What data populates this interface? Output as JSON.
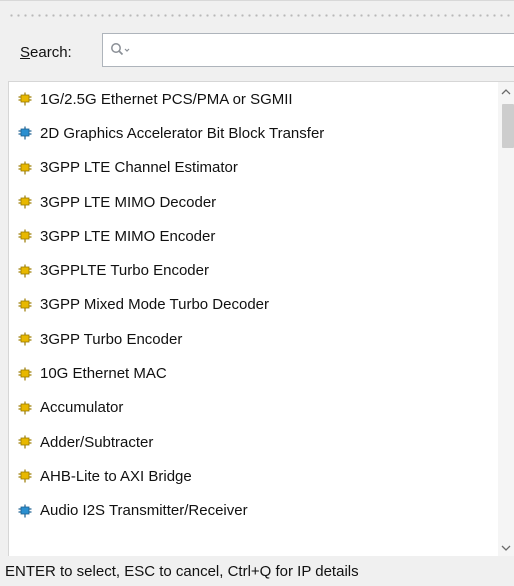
{
  "search": {
    "label": "Search:",
    "value": "",
    "placeholder": ""
  },
  "ip_list": {
    "items": [
      {
        "label": "1G/2.5G Ethernet PCS/PMA or SGMII",
        "icon": "ip-core-icon",
        "icon_color": "#e8b800"
      },
      {
        "label": "2D Graphics Accelerator Bit Block Transfer",
        "icon": "ip-core-icon",
        "icon_color": "#2a8fd0"
      },
      {
        "label": "3GPP LTE Channel Estimator",
        "icon": "ip-core-icon",
        "icon_color": "#e8b800"
      },
      {
        "label": "3GPP LTE MIMO Decoder",
        "icon": "ip-core-icon",
        "icon_color": "#e8b800"
      },
      {
        "label": "3GPP LTE MIMO Encoder",
        "icon": "ip-core-icon",
        "icon_color": "#e8b800"
      },
      {
        "label": "3GPPLTE Turbo Encoder",
        "icon": "ip-core-icon",
        "icon_color": "#e8b800"
      },
      {
        "label": "3GPP Mixed Mode Turbo Decoder",
        "icon": "ip-core-icon",
        "icon_color": "#e8b800"
      },
      {
        "label": "3GPP Turbo Encoder",
        "icon": "ip-core-icon",
        "icon_color": "#e8b800"
      },
      {
        "label": "10G Ethernet MAC",
        "icon": "ip-core-icon",
        "icon_color": "#e8b800"
      },
      {
        "label": "Accumulator",
        "icon": "ip-core-icon",
        "icon_color": "#e8b800"
      },
      {
        "label": "Adder/Subtracter",
        "icon": "ip-core-icon",
        "icon_color": "#e8b800"
      },
      {
        "label": "AHB-Lite to AXI Bridge",
        "icon": "ip-core-icon",
        "icon_color": "#e8b800"
      },
      {
        "label": "Audio I2S Transmitter/Receiver",
        "icon": "ip-core-icon",
        "icon_color": "#2a8fd0"
      }
    ],
    "scroll_position": 0.0
  },
  "status": {
    "text": "ENTER to select, ESC to cancel, Ctrl+Q for IP details"
  }
}
